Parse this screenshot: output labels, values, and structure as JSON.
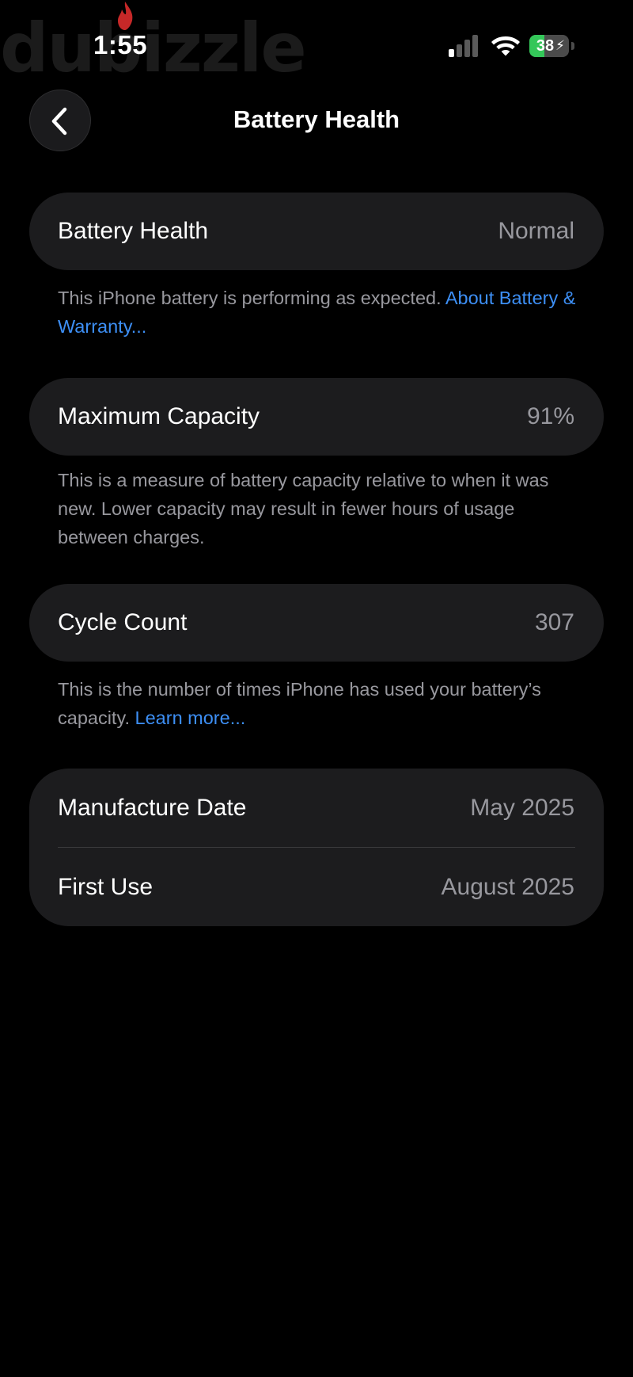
{
  "watermark": {
    "text": "dubizzle",
    "color": "#1b1b1b",
    "accent": "#c62828"
  },
  "status_bar": {
    "time": "1:55",
    "signal_icon": "cellular-signal-icon",
    "wifi_icon": "wifi-icon",
    "battery_percent": "38",
    "battery_level": 0.38,
    "charging": true,
    "battery_color": "#34c759"
  },
  "nav": {
    "back_icon": "chevron-left-icon",
    "title": "Battery Health"
  },
  "battery_health": {
    "label": "Battery Health",
    "value": "Normal",
    "description": "This iPhone battery is performing as expected.",
    "link": "About Battery & Warranty..."
  },
  "maximum_capacity": {
    "label": "Maximum Capacity",
    "value": "91%",
    "description": "This is a measure of battery capacity relative to when it was new. Lower capacity may result in fewer hours of usage between charges."
  },
  "cycle_count": {
    "label": "Cycle Count",
    "value": "307",
    "description": "This is the number of times iPhone has used your battery’s capacity.",
    "link": "Learn more..."
  },
  "dates": {
    "manufacture_label": "Manufacture Date",
    "manufacture_value": "May 2025",
    "first_use_label": "First Use",
    "first_use_value": "August 2025"
  },
  "colors": {
    "background": "#000000",
    "card": "#1c1c1e",
    "secondary_text": "#98989e",
    "link": "#3d8ff5"
  }
}
